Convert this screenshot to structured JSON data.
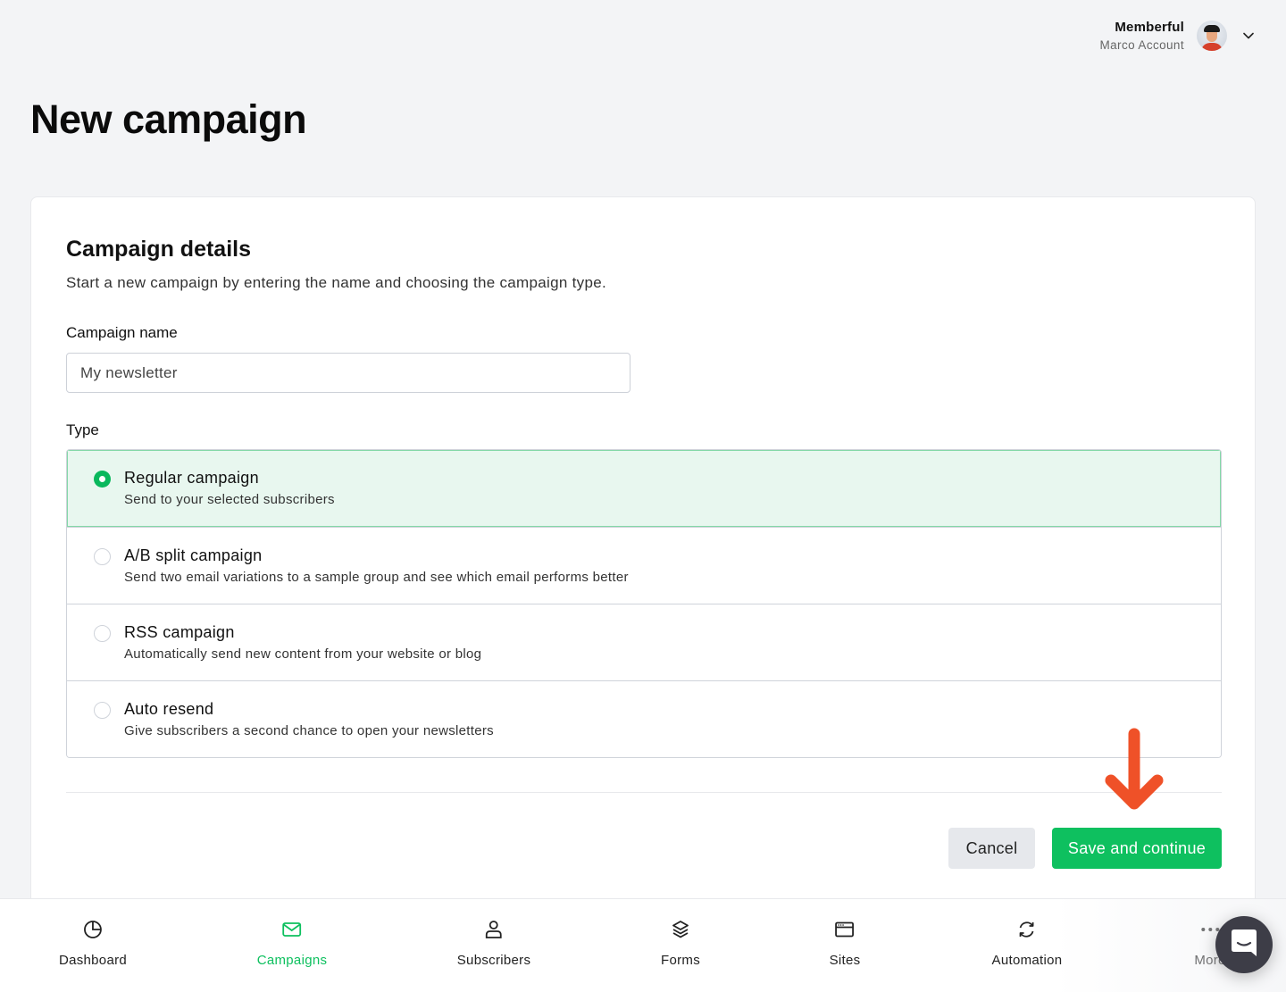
{
  "account": {
    "name": "Memberful",
    "subtitle": "Marco Account",
    "avatar_icon": "user-avatar",
    "menu_icon": "chevron-down-icon"
  },
  "page": {
    "title": "New campaign"
  },
  "details": {
    "title": "Campaign details",
    "description": "Start a new campaign by entering the name and choosing the campaign type.",
    "name_label": "Campaign name",
    "name_value": "My newsletter",
    "type_label": "Type",
    "types": [
      {
        "title": "Regular campaign",
        "description": "Send to your selected subscribers",
        "selected": true
      },
      {
        "title": "A/B split campaign",
        "description": "Send two email variations to a sample group and see which email performs better",
        "selected": false
      },
      {
        "title": "RSS campaign",
        "description": "Automatically send new content from your website or blog",
        "selected": false
      },
      {
        "title": "Auto resend",
        "description": "Give subscribers a second chance to open your newsletters",
        "selected": false
      }
    ]
  },
  "actions": {
    "cancel_label": "Cancel",
    "save_label": "Save and continue"
  },
  "annotation": {
    "arrow_icon": "arrow-down-icon",
    "color": "#ef5128"
  },
  "nav": {
    "items": [
      {
        "label": "Dashboard",
        "icon": "pie-chart-icon",
        "active": false
      },
      {
        "label": "Campaigns",
        "icon": "mail-icon",
        "active": true
      },
      {
        "label": "Subscribers",
        "icon": "user-icon",
        "active": false
      },
      {
        "label": "Forms",
        "icon": "layers-icon",
        "active": false
      },
      {
        "label": "Sites",
        "icon": "browser-window-icon",
        "active": false
      },
      {
        "label": "Automation",
        "icon": "refresh-icon",
        "active": false
      },
      {
        "label": "More",
        "icon": "more-dots-icon",
        "active": false
      }
    ]
  },
  "chat": {
    "icon": "chat-bubble-icon"
  },
  "colors": {
    "accent": "#0ec05f",
    "selected_bg": "#e8f7ef",
    "background": "#f3f4f6"
  }
}
